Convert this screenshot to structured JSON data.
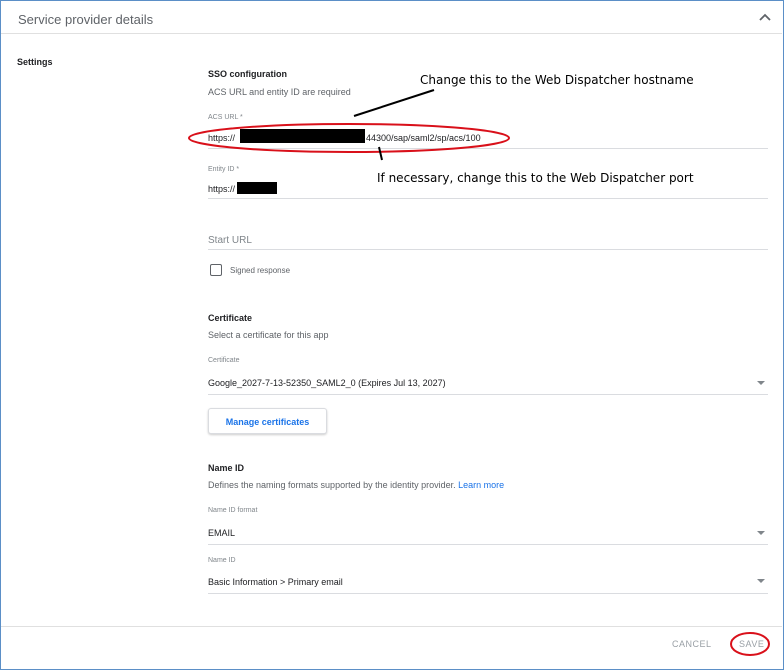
{
  "header": {
    "title": "Service provider details",
    "collapse_icon": "chevron-up-icon"
  },
  "settings_label": "Settings",
  "sso": {
    "title": "SSO configuration",
    "subtitle": "ACS URL and entity ID are required",
    "acs_label": "ACS URL *",
    "acs_prefix": "https://",
    "acs_suffix": "44300/sap/saml2/sp/acs/100",
    "entity_label": "Entity ID *",
    "entity_prefix": "https://",
    "start_url_placeholder": "Start URL",
    "signed_response_label": "Signed response",
    "signed_response_checked": false
  },
  "certificate": {
    "title": "Certificate",
    "subtitle": "Select a certificate for this app",
    "field_label": "Certificate",
    "value": "Google_2027-7-13-52350_SAML2_0 (Expires Jul 13, 2027)",
    "manage_button": "Manage certificates"
  },
  "name_id": {
    "title": "Name ID",
    "subtitle": "Defines the naming formats supported by the identity provider.",
    "learn_more": "Learn more",
    "format_label": "Name ID format",
    "format_value": "EMAIL",
    "name_id_label": "Name ID",
    "name_id_value": "Basic Information > Primary email"
  },
  "footer": {
    "cancel": "CANCEL",
    "save": "SAVE"
  },
  "annotations": {
    "hostname_note": "Change this to the Web Dispatcher hostname",
    "port_note": "If necessary, change this to the Web Dispatcher port",
    "highlight_color": "#d9101a"
  }
}
